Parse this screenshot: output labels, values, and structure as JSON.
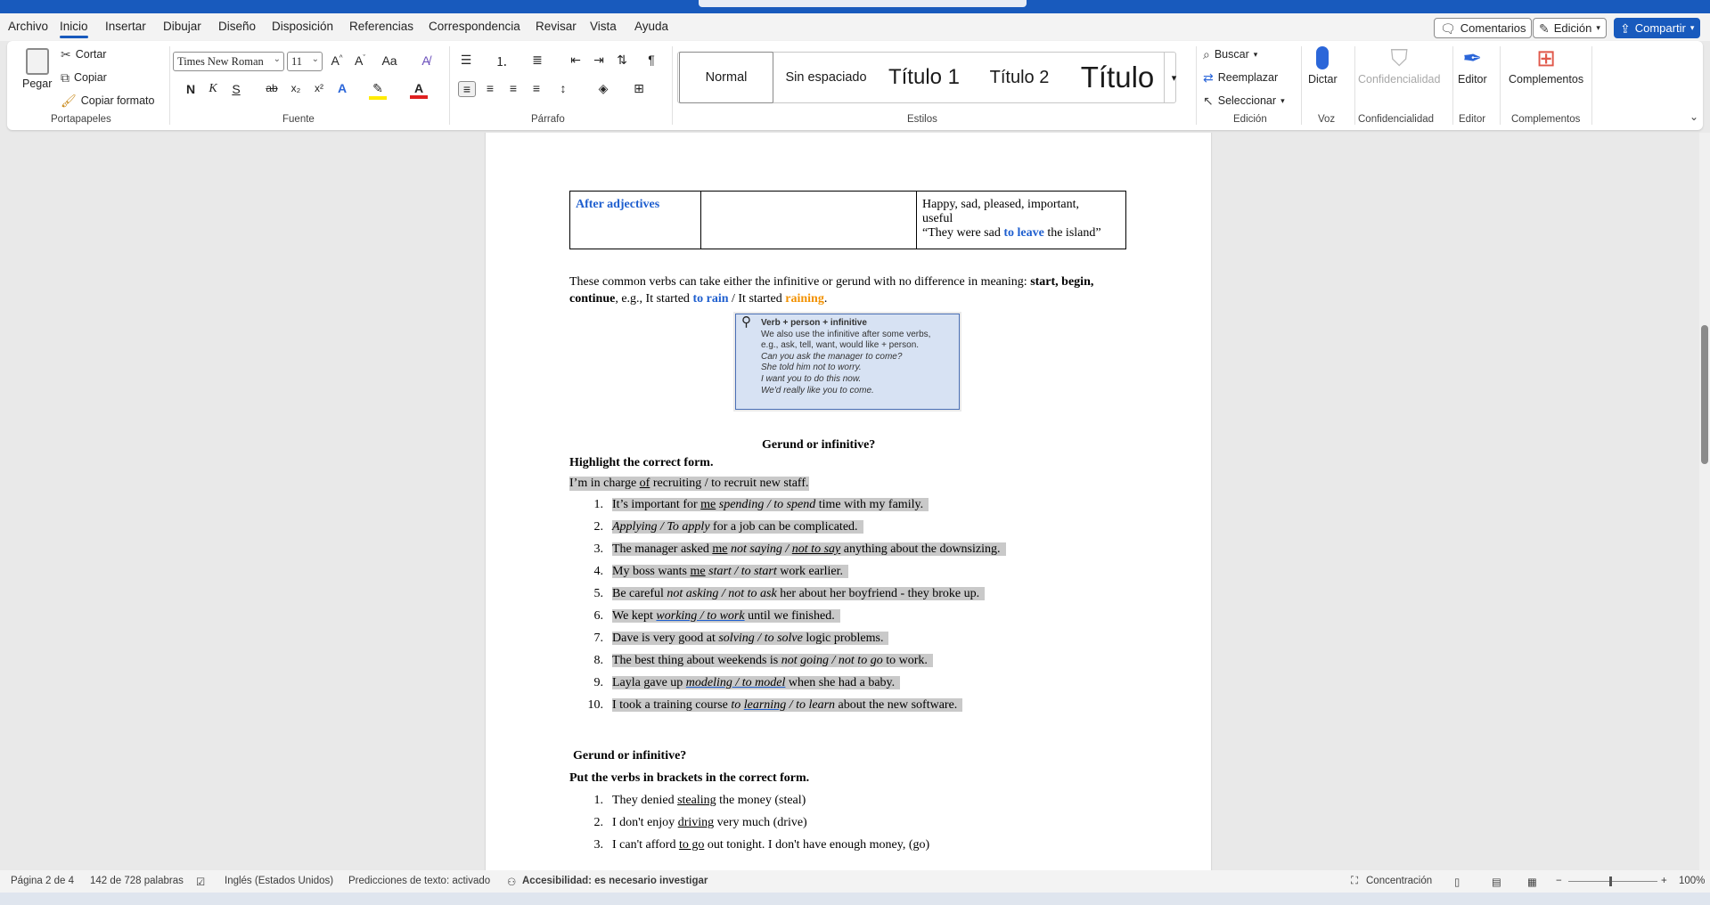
{
  "menu": {
    "tabs": [
      "Archivo",
      "Inicio",
      "Insertar",
      "Dibujar",
      "Diseño",
      "Disposición",
      "Referencias",
      "Correspondencia",
      "Revisar",
      "Vista",
      "Ayuda"
    ],
    "active_tab": "Inicio",
    "comments": "Comentarios",
    "editing": "Edición",
    "share": "Compartir"
  },
  "ribbon": {
    "clipboard": {
      "paste": "Pegar",
      "cut": "Cortar",
      "copy": "Copiar",
      "format_painter": "Copiar formato",
      "label": "Portapapeles"
    },
    "font": {
      "name": "Times New Roman",
      "size": "11",
      "case": "Aa",
      "label": "Fuente",
      "bold": "N",
      "italic": "K",
      "underline": "S",
      "strike": "ab",
      "sub": "x₂",
      "sup": "x²"
    },
    "paragraph": {
      "label": "Párrafo"
    },
    "styles": {
      "items": [
        "Normal",
        "Sin espaciado",
        "Título 1",
        "Título 2",
        "Título"
      ],
      "label": "Estilos"
    },
    "editing": {
      "find": "Buscar",
      "replace": "Reemplazar",
      "select": "Seleccionar",
      "label": "Edición"
    },
    "voice": {
      "dictate": "Dictar",
      "label": "Voz"
    },
    "sensitivity": {
      "button": "Confidencialidad",
      "label": "Confidencialidad"
    },
    "editor": {
      "button": "Editor",
      "label": "Editor"
    },
    "addins": {
      "button": "Complementos",
      "label": "Complementos"
    }
  },
  "document": {
    "table": {
      "col1": "After adjectives",
      "col3_line1": "Happy, sad, pleased, important,",
      "col3_line2": "useful",
      "col3_q1": "“They were sad ",
      "col3_q2": "to leave",
      "col3_q3": " the island”"
    },
    "para1": {
      "a": "These common verbs can take either the infinitive or gerund with no difference in meaning: ",
      "b": "start, begin,",
      "c": "continue",
      "d": ", e.g., It started ",
      "e": "to rain",
      "f": " / It started ",
      "g": "raining",
      "h": "."
    },
    "image_box": {
      "title": "Verb + person + infinitive",
      "lines": [
        "We also use the infinitive after some verbs,",
        "e.g., ask, tell, want, would like + person.",
        "Can you ask the manager to come?",
        "She told him not to worry.",
        "I want you to do this now.",
        "We'd really like you to come."
      ]
    },
    "section1": {
      "title": "Gerund or infinitive?",
      "instruction": "Highlight the correct form.",
      "example": "I'm in charge of recruiting / to recruit new staff.",
      "items": [
        "It's important for me spending / to spend time with my family.",
        "Applying / To apply for a job can be complicated.",
        "The manager asked me not saying / not to say anything about the downsizing.",
        "My boss wants me start / to start work earlier.",
        "Be careful not asking / not to ask her about her boyfriend - they broke up.",
        "We kept working / to work until we finished.",
        "Dave is very good at solving / to solve logic problems.",
        "The best thing about weekends is not going / not to go to work.",
        "Layla gave up modeling / to model when she had a baby.",
        "I took a training course to learning / to learn about the new software."
      ]
    },
    "section2": {
      "title": "Gerund or infinitive?",
      "instruction": "Put the verbs in brackets in the correct form.",
      "items": [
        "They denied stealing the money (steal)",
        "I don't enjoy driving very much (drive)",
        "I can't afford to go out tonight. I don't have enough money, (go)"
      ]
    }
  },
  "status": {
    "page": "Página 2 de 4",
    "words": "142 de 728 palabras",
    "language": "Inglés (Estados Unidos)",
    "predictions": "Predicciones de texto: activado",
    "accessibility": "Accesibilidad: es necesario investigar",
    "focus": "Concentración",
    "zoom": "100%"
  }
}
